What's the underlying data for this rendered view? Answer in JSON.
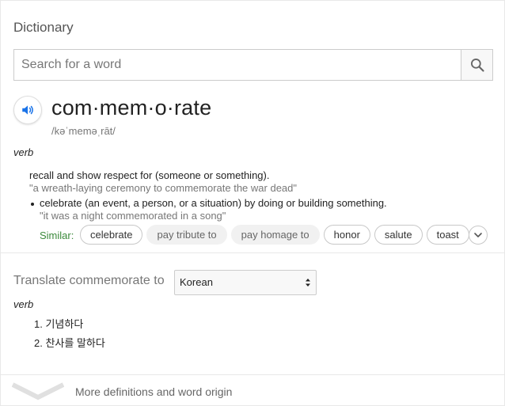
{
  "widget": {
    "title": "Dictionary"
  },
  "search": {
    "placeholder": "Search for a word",
    "button_icon": "search-icon"
  },
  "entry": {
    "speaker_icon": "speaker-icon",
    "headword": "com·mem·o·rate",
    "phonetic": "/kəˈmeməˌrāt/",
    "part_of_speech": "verb",
    "definition": "recall and show respect for (someone or something).",
    "example": "\"a wreath-laying ceremony to commemorate the war dead\"",
    "sub_definition": "celebrate (an event, a person, or a situation) by doing or building something.",
    "sub_example": "\"it was a night commemorated in a song\"",
    "similar_label": "Similar:",
    "similar": [
      {
        "label": "celebrate",
        "style": "outlined"
      },
      {
        "label": "pay tribute to",
        "style": "filled"
      },
      {
        "label": "pay homage to",
        "style": "filled"
      },
      {
        "label": "honor",
        "style": "outlined"
      },
      {
        "label": "salute",
        "style": "outlined"
      },
      {
        "label": "toast",
        "style": "outlined"
      }
    ],
    "more_similar_icon": "chevron-down-icon"
  },
  "translate": {
    "label": "Translate commemorate to",
    "selected_language": "Korean",
    "part_of_speech": "verb",
    "translations": [
      "1. 기념하다",
      "2. 찬사를 말하다"
    ]
  },
  "footer": {
    "more_label": "More definitions and word origin",
    "chevron_icon": "chevron-down-icon"
  },
  "colors": {
    "accent_blue": "#1a73e8",
    "similar_green": "#3c8a3c",
    "muted_text": "#777777"
  }
}
